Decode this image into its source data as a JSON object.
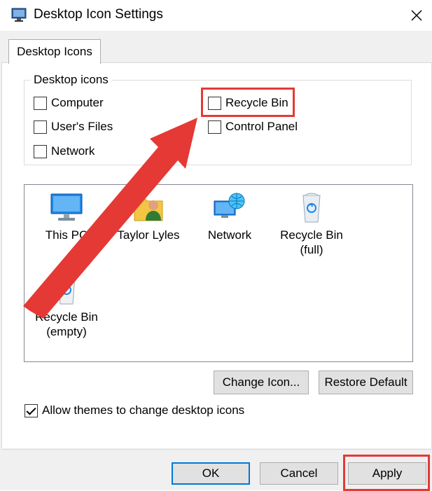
{
  "window": {
    "title": "Desktop Icon Settings"
  },
  "tab": {
    "label": "Desktop Icons"
  },
  "desktop_icons_group": {
    "label": "Desktop icons",
    "checkboxes": [
      {
        "label": "Computer",
        "checked": false
      },
      {
        "label": "User's Files",
        "checked": false
      },
      {
        "label": "Network",
        "checked": false
      },
      {
        "label": "Recycle Bin",
        "checked": false
      },
      {
        "label": "Control Panel",
        "checked": false
      }
    ]
  },
  "icon_list": [
    {
      "label": "This PC",
      "icon": "monitor-icon"
    },
    {
      "label": "Taylor Lyles",
      "icon": "user-folder-icon"
    },
    {
      "label": "Network",
      "icon": "network-globe-icon"
    },
    {
      "label": "Recycle Bin\n(full)",
      "icon": "recycle-bin-full-icon"
    },
    {
      "label": "Recycle Bin\n(empty)",
      "icon": "recycle-bin-empty-icon"
    }
  ],
  "buttons": {
    "change_icon": "Change Icon...",
    "restore_default": "Restore Default",
    "ok": "OK",
    "cancel": "Cancel",
    "apply": "Apply"
  },
  "allow_themes": {
    "label": "Allow themes to change desktop icons",
    "checked": true
  },
  "colors": {
    "highlight": "#e53935",
    "accent": "#0078d7"
  }
}
